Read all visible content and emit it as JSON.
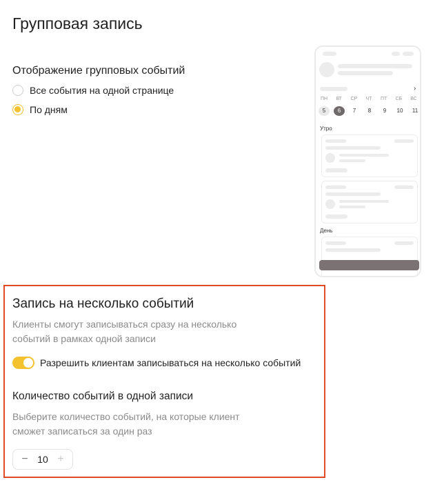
{
  "page": {
    "title": "Групповая запись"
  },
  "display": {
    "title": "Отображение групповых событий",
    "options": [
      {
        "label": "Все события на одной странице",
        "checked": false
      },
      {
        "label": "По дням",
        "checked": true
      }
    ]
  },
  "preview": {
    "day_names": [
      "ПН",
      "ВТ",
      "СР",
      "ЧТ",
      "ПТ",
      "СБ",
      "ВС"
    ],
    "day_numbers": [
      "5",
      "6",
      "7",
      "8",
      "9",
      "10",
      "11"
    ],
    "section_morning": "Утро",
    "section_day": "День"
  },
  "multi": {
    "title": "Запись на несколько событий",
    "description": "Клиенты смогут записываться сразу на несколько событий в рамках одной записи",
    "toggle_label": "Разрешить клиентам записываться на несколько событий",
    "toggle_on": true,
    "count_title": "Количество событий в одной записи",
    "count_description": "Выберите количество событий, на которые клиент сможет записаться за один раз",
    "count_value": "10",
    "minus": "−",
    "plus": "+"
  },
  "colors": {
    "accent": "#f3c22e",
    "highlight_border": "#e04a24",
    "preview_button": "#7b7373"
  }
}
